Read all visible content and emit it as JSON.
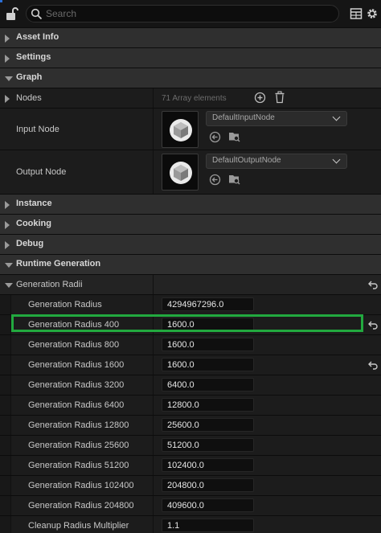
{
  "toolbar": {
    "search_placeholder": "Search",
    "icons": [
      "lock-open-icon",
      "search-icon",
      "table-icon",
      "gear-icon"
    ]
  },
  "categories": {
    "asset_info": "Asset Info",
    "settings": "Settings",
    "graph": "Graph",
    "instance": "Instance",
    "cooking": "Cooking",
    "debug": "Debug",
    "runtime_generation": "Runtime Generation"
  },
  "graph": {
    "nodes_label": "Nodes",
    "nodes_count": "71 Array elements",
    "input_node_label": "Input Node",
    "input_node_value": "DefaultInputNode",
    "output_node_label": "Output Node",
    "output_node_value": "DefaultOutputNode"
  },
  "runtime": {
    "group_label": "Generation Radii",
    "rows": [
      {
        "label": "Generation Radius",
        "value": "4294967296.0"
      },
      {
        "label": "Generation Radius 400",
        "value": "1600.0"
      },
      {
        "label": "Generation Radius 800",
        "value": "1600.0"
      },
      {
        "label": "Generation Radius 1600",
        "value": "1600.0"
      },
      {
        "label": "Generation Radius 3200",
        "value": "6400.0"
      },
      {
        "label": "Generation Radius 6400",
        "value": "12800.0"
      },
      {
        "label": "Generation Radius 12800",
        "value": "25600.0"
      },
      {
        "label": "Generation Radius 25600",
        "value": "51200.0"
      },
      {
        "label": "Generation Radius 51200",
        "value": "102400.0"
      },
      {
        "label": "Generation Radius 102400",
        "value": "204800.0"
      },
      {
        "label": "Generation Radius 204800",
        "value": "409600.0"
      }
    ],
    "cleanup_label": "Cleanup Radius Multiplier",
    "cleanup_value": "1.1"
  },
  "colors": {
    "highlight": "#22a93f",
    "accent": "#2b6fd6"
  }
}
